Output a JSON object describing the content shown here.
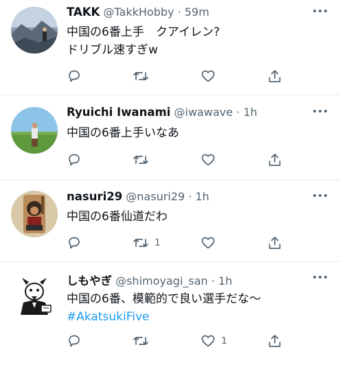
{
  "tweets": [
    {
      "name": "TAKK",
      "handle": "@TakkHobby",
      "time": "· 59m",
      "lines": [
        "中国の6番上手　クアイレン?",
        "ドリブル速すぎw"
      ],
      "hashtag": "",
      "retweets": "",
      "likes": ""
    },
    {
      "name": "Ryuichi Iwanami",
      "handle": "@iwawave",
      "time": "· 1h",
      "lines": [
        "中国の6番上手いなあ"
      ],
      "hashtag": "",
      "retweets": "",
      "likes": ""
    },
    {
      "name": "nasuri29",
      "handle": "@nasuri29",
      "time": "· 1h",
      "lines": [
        "中国の6番仙道だわ"
      ],
      "hashtag": "",
      "retweets": "1",
      "likes": ""
    },
    {
      "name": "しもやぎ",
      "handle": "@shimoyagi_san",
      "time": "· 1h",
      "lines": [
        "中国の6番、模範的で良い選手だな～"
      ],
      "hashtag": "#AkatsukiFive",
      "retweets": "",
      "likes": "1"
    }
  ],
  "colors": {
    "text": "#0f1419",
    "secondary": "#536471",
    "accent": "#1d9bf0",
    "divider": "#e6e9eb"
  },
  "icons": [
    "reply-icon",
    "retweet-icon",
    "like-icon",
    "share-icon",
    "more-icon"
  ]
}
